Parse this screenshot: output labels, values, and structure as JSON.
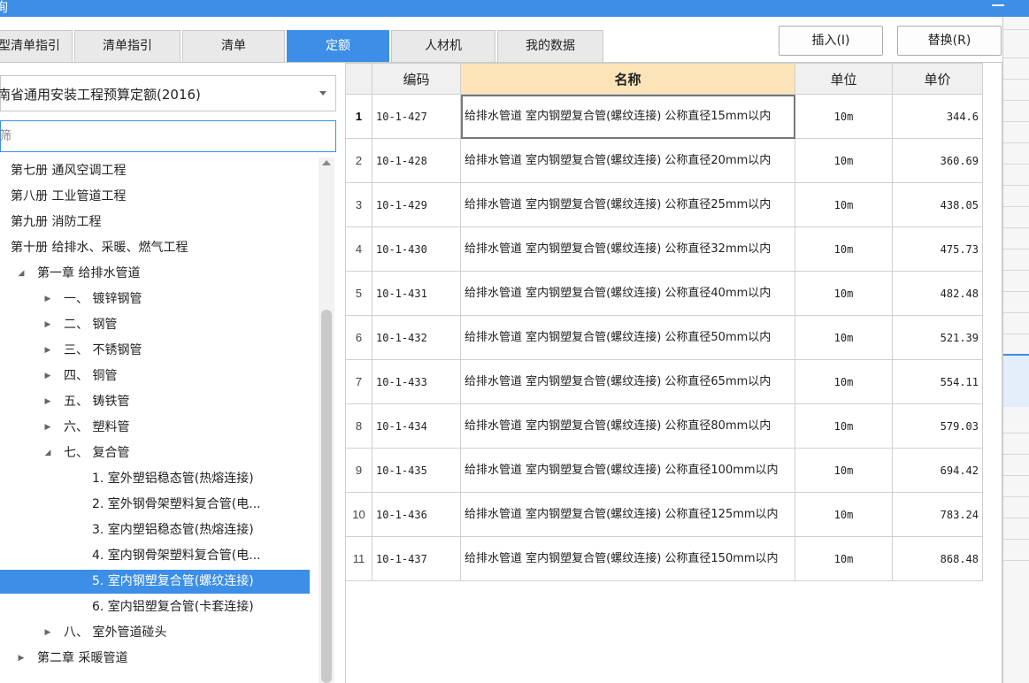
{
  "window": {
    "title_fragment": "询"
  },
  "tabs": [
    {
      "label": "型清单指引"
    },
    {
      "label": "清单指引"
    },
    {
      "label": "清单"
    },
    {
      "label": "定额"
    },
    {
      "label": "人材机"
    },
    {
      "label": "我的数据"
    }
  ],
  "active_tab": "定额",
  "buttons": {
    "insert": "插入(I)",
    "replace": "替换(R)"
  },
  "quota_library": {
    "selected": "南省通用安装工程预算定额(2016)"
  },
  "filter": {
    "placeholder": "筛",
    "value": ""
  },
  "tree": [
    {
      "label": "第七册 通风空调工程",
      "toggle": ""
    },
    {
      "label": "第八册 工业管道工程",
      "toggle": ""
    },
    {
      "label": "第九册 消防工程",
      "toggle": ""
    },
    {
      "label": "第十册 给排水、采暖、燃气工程",
      "toggle": ""
    },
    {
      "label": "第一章 给排水管道",
      "toggle": "◢"
    },
    {
      "label": "一、 镀锌钢管",
      "toggle": "▶"
    },
    {
      "label": "二、 钢管",
      "toggle": "▶"
    },
    {
      "label": "三、 不锈钢管",
      "toggle": "▶"
    },
    {
      "label": "四、 铜管",
      "toggle": "▶"
    },
    {
      "label": "五、 铸铁管",
      "toggle": "▶"
    },
    {
      "label": "六、 塑料管",
      "toggle": "▶"
    },
    {
      "label": "七、 复合管",
      "toggle": "◢"
    },
    {
      "label": "1. 室外塑铝稳态管(热熔连接)",
      "toggle": ""
    },
    {
      "label": "2. 室外钢骨架塑料复合管(电...",
      "toggle": ""
    },
    {
      "label": "3. 室内塑铝稳态管(热熔连接)",
      "toggle": ""
    },
    {
      "label": "4. 室内钢骨架塑料复合管(电...",
      "toggle": ""
    },
    {
      "label": "5. 室内钢塑复合管(螺纹连接)",
      "toggle": ""
    },
    {
      "label": "6. 室内铝塑复合管(卡套连接)",
      "toggle": ""
    },
    {
      "label": "八、 室外管道碰头",
      "toggle": "▶"
    },
    {
      "label": "第二章 采暖管道",
      "toggle": "▶"
    }
  ],
  "tree_selected_index": 16,
  "grid": {
    "columns": {
      "code": "编码",
      "name": "名称",
      "unit": "单位",
      "price": "单价"
    },
    "rows": [
      {
        "idx": "1",
        "code": "10-1-427",
        "name": "给排水管道 室内钢塑复合管(螺纹连接) 公称直径15mm以内",
        "unit": "10m",
        "price": "344.6"
      },
      {
        "idx": "2",
        "code": "10-1-428",
        "name": "给排水管道 室内钢塑复合管(螺纹连接) 公称直径20mm以内",
        "unit": "10m",
        "price": "360.69"
      },
      {
        "idx": "3",
        "code": "10-1-429",
        "name": "给排水管道 室内钢塑复合管(螺纹连接) 公称直径25mm以内",
        "unit": "10m",
        "price": "438.05"
      },
      {
        "idx": "4",
        "code": "10-1-430",
        "name": "给排水管道 室内钢塑复合管(螺纹连接) 公称直径32mm以内",
        "unit": "10m",
        "price": "475.73"
      },
      {
        "idx": "5",
        "code": "10-1-431",
        "name": "给排水管道 室内钢塑复合管(螺纹连接) 公称直径40mm以内",
        "unit": "10m",
        "price": "482.48"
      },
      {
        "idx": "6",
        "code": "10-1-432",
        "name": "给排水管道 室内钢塑复合管(螺纹连接) 公称直径50mm以内",
        "unit": "10m",
        "price": "521.39"
      },
      {
        "idx": "7",
        "code": "10-1-433",
        "name": "给排水管道 室内钢塑复合管(螺纹连接) 公称直径65mm以内",
        "unit": "10m",
        "price": "554.11"
      },
      {
        "idx": "8",
        "code": "10-1-434",
        "name": "给排水管道 室内钢塑复合管(螺纹连接) 公称直径80mm以内",
        "unit": "10m",
        "price": "579.03"
      },
      {
        "idx": "9",
        "code": "10-1-435",
        "name": "给排水管道 室内钢塑复合管(螺纹连接) 公称直径100mm以内",
        "unit": "10m",
        "price": "694.42"
      },
      {
        "idx": "10",
        "code": "10-1-436",
        "name": "给排水管道 室内钢塑复合管(螺纹连接) 公称直径125mm以内",
        "unit": "10m",
        "price": "783.24"
      },
      {
        "idx": "11",
        "code": "10-1-437",
        "name": "给排水管道 室内钢塑复合管(螺纹连接) 公称直径150mm以内",
        "unit": "10m",
        "price": "868.48"
      }
    ]
  },
  "colors": {
    "accent": "#3c8ee6",
    "name_header_bg": "#fce4b8"
  }
}
